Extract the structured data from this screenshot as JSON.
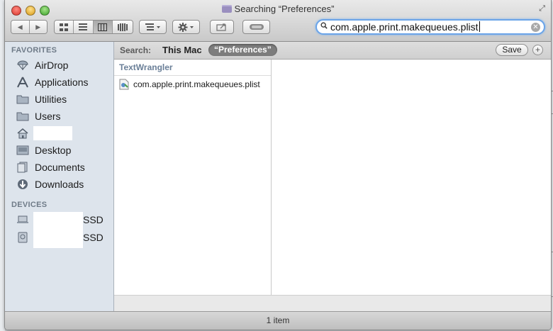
{
  "window": {
    "title": "Searching “Preferences”"
  },
  "toolbar": {
    "back_glyph": "◀",
    "forward_glyph": "▶",
    "search": {
      "value": "com.apple.print.makequeues.plist"
    }
  },
  "sidebar": {
    "favorites_header": "FAVORITES",
    "favorites": [
      {
        "label": "AirDrop",
        "icon": "airdrop-icon"
      },
      {
        "label": "Applications",
        "icon": "applications-icon"
      },
      {
        "label": "Utilities",
        "icon": "folder-icon"
      },
      {
        "label": "Users",
        "icon": "folder-icon"
      },
      {
        "label": "",
        "icon": "home-icon"
      },
      {
        "label": "Desktop",
        "icon": "desktop-icon"
      },
      {
        "label": "Documents",
        "icon": "documents-icon"
      },
      {
        "label": "Downloads",
        "icon": "downloads-icon"
      }
    ],
    "devices_header": "DEVICES",
    "devices": [
      {
        "label": "SSD",
        "icon": "laptop-icon"
      },
      {
        "label": "SSD",
        "icon": "disk-icon"
      }
    ]
  },
  "scope_bar": {
    "label": "Search:",
    "this_mac": "This Mac",
    "preferences": "“Preferences”",
    "save": "Save",
    "plus": "+"
  },
  "results": {
    "group": "TextWrangler",
    "items": [
      {
        "name": "com.apple.print.makequeues.plist"
      }
    ]
  },
  "status": {
    "text": "1 item"
  }
}
